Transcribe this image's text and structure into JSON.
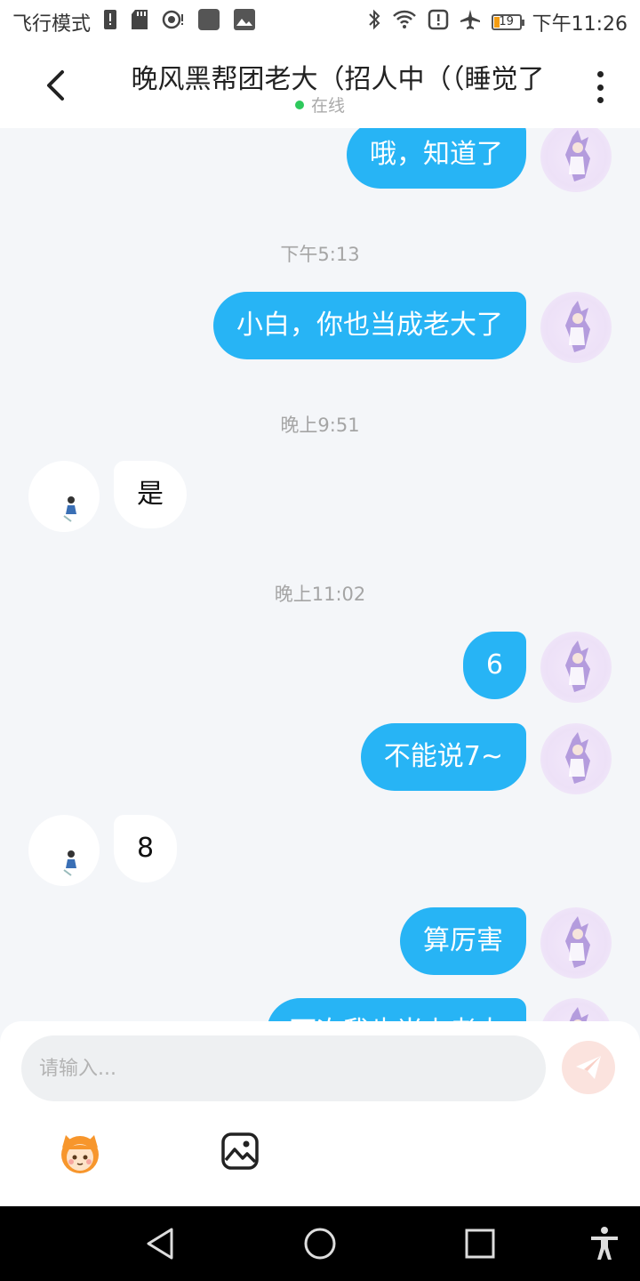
{
  "status_bar": {
    "airplane_mode_label": "飞行模式",
    "battery_level": "19",
    "time": "下午11:26",
    "icons": [
      "sim-alert-icon",
      "sd-card-icon",
      "hotspot-icon",
      "app-icon",
      "gallery-icon",
      "bluetooth-icon",
      "wifi-icon",
      "alert-icon",
      "airplane-icon",
      "battery-icon"
    ]
  },
  "header": {
    "title": "晚风黑帮团老大（招人中（（睡觉了",
    "status": "在线",
    "status_color": "#2ec95c"
  },
  "messages": [
    {
      "type": "outgoing",
      "text": "哦，知道了"
    },
    {
      "type": "time",
      "text": "下午5:13"
    },
    {
      "type": "outgoing",
      "text": "小白，你也当成老大了"
    },
    {
      "type": "time",
      "text": "晚上9:51"
    },
    {
      "type": "incoming",
      "text": "是"
    },
    {
      "type": "time",
      "text": "晚上11:02"
    },
    {
      "type": "outgoing",
      "text": "6"
    },
    {
      "type": "outgoing",
      "text": "不能说7~"
    },
    {
      "type": "incoming",
      "text": "8"
    },
    {
      "type": "outgoing",
      "text": "算厉害"
    },
    {
      "type": "outgoing",
      "text": "下次我也当上老大"
    }
  ],
  "composer": {
    "placeholder": "请输入...",
    "send_icon": "send-plane-icon",
    "sticker_icon": "sticker-icon",
    "image_icon": "image-icon"
  },
  "nav_bar": {
    "icons": [
      "back-triangle-icon",
      "home-circle-icon",
      "recents-square-icon",
      "accessibility-icon"
    ]
  },
  "colors": {
    "outgoing_bubble": "#27b4f5",
    "incoming_bubble": "#ffffff",
    "background": "#f4f6f9"
  }
}
